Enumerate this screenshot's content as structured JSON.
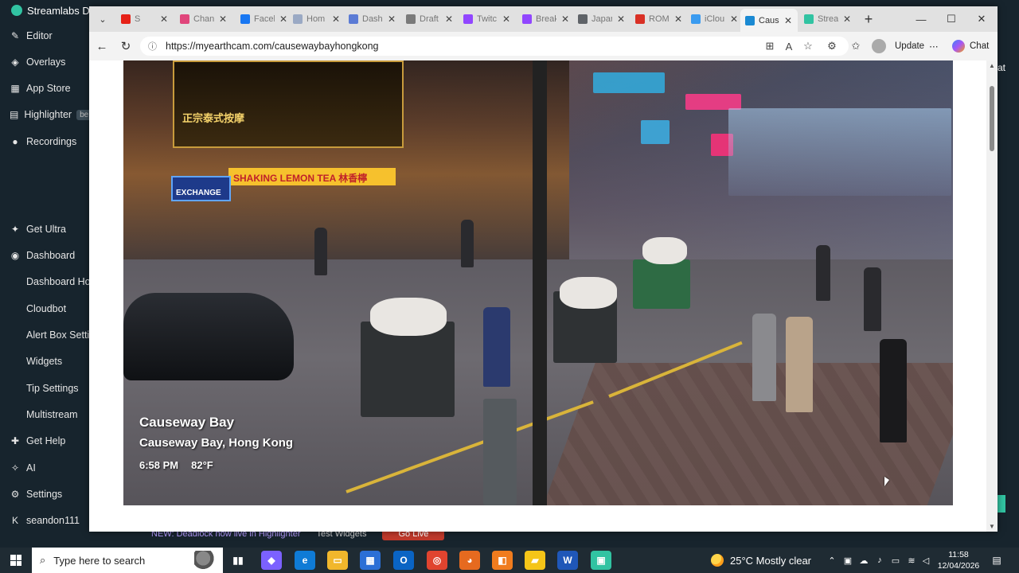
{
  "streamlabs": {
    "title": "Streamlabs Des",
    "nav": [
      {
        "label": "Editor",
        "icon": "pencil-icon",
        "glyph": "✎"
      },
      {
        "label": "Overlays",
        "icon": "overlays-icon",
        "glyph": "◈"
      },
      {
        "label": "App Store",
        "icon": "app-store-icon",
        "glyph": "▦"
      },
      {
        "label": "Highlighter",
        "icon": "highlighter-icon",
        "glyph": "▤",
        "badge": "be"
      },
      {
        "label": "Recordings",
        "icon": "recordings-icon",
        "glyph": "●"
      },
      {
        "label": "Get Ultra",
        "icon": "ultra-icon",
        "glyph": "✦"
      },
      {
        "label": "Dashboard",
        "icon": "dashboard-icon",
        "glyph": "◉"
      },
      {
        "label": "Dashboard Hom"
      },
      {
        "label": "Cloudbot"
      },
      {
        "label": "Alert Box Settin"
      },
      {
        "label": "Widgets"
      },
      {
        "label": "Tip Settings"
      },
      {
        "label": "Multistream"
      },
      {
        "label": "Get Help",
        "icon": "help-icon",
        "glyph": "✚"
      },
      {
        "label": "AI",
        "icon": "ai-icon",
        "glyph": "✧"
      },
      {
        "label": "Settings",
        "icon": "settings-gear-icon",
        "glyph": "⚙"
      },
      {
        "label": "seandon111",
        "icon": "kick-icon",
        "glyph": "K"
      }
    ],
    "right_peek": "at",
    "bottom_strip": {
      "news": "NEW: Deadlock now live in Highlighter",
      "test_widgets": "Test Widgets",
      "go_live": "Go Live"
    }
  },
  "browser": {
    "tabs": [
      {
        "label": "S",
        "color": "#e62117",
        "active": false
      },
      {
        "label": "Chan",
        "color": "#e0457b",
        "active": false
      },
      {
        "label": "Faceb",
        "color": "#1877f2",
        "active": false
      },
      {
        "label": "Hom",
        "color": "#9aa9c4",
        "active": false
      },
      {
        "label": "Dashi",
        "color": "#5b7bd5",
        "active": false
      },
      {
        "label": "Draft",
        "color": "#7a7a7a",
        "active": false
      },
      {
        "label": "Twitc",
        "color": "#9146ff",
        "active": false
      },
      {
        "label": "Break",
        "color": "#9146ff",
        "active": false
      },
      {
        "label": "Japan",
        "color": "#5f6368",
        "active": false
      },
      {
        "label": "ROM",
        "color": "#d93025",
        "active": false
      },
      {
        "label": "iClou",
        "color": "#3a9bf0",
        "active": false
      },
      {
        "label": "Caus",
        "color": "#1b8ad3",
        "active": true
      },
      {
        "label": "Strea",
        "color": "#31c3a2",
        "active": false
      }
    ],
    "url": "https://myearthcam.com/causewaybayhongkong",
    "update_label": "Update",
    "chat_label": "Chat"
  },
  "cam": {
    "title": "Causeway Bay",
    "location": "Causeway Bay, Hong Kong",
    "time": "6:58 PM",
    "temp": "82°F",
    "signs": {
      "thai": "正宗泰式按摩",
      "lemontea": "SHAKING LEMON TEA 林香檸",
      "exchange": "EXCHANGE"
    }
  },
  "taskbar": {
    "search_placeholder": "Type here to search",
    "apps": [
      {
        "name": "task-view",
        "color": "#1f2b33",
        "glyph": "▮▮"
      },
      {
        "name": "copilot",
        "color": "#7b61ff",
        "glyph": "◆"
      },
      {
        "name": "edge",
        "color": "#0f7bd6",
        "glyph": "e"
      },
      {
        "name": "file-explorer",
        "color": "#f1b72c",
        "glyph": "▭"
      },
      {
        "name": "store",
        "color": "#2b6fd6",
        "glyph": "▦"
      },
      {
        "name": "outlook",
        "color": "#0a64c4",
        "glyph": "O"
      },
      {
        "name": "chrome",
        "color": "#e0442f",
        "glyph": "◎"
      },
      {
        "name": "firefox",
        "color": "#e66a1f",
        "glyph": "◕"
      },
      {
        "name": "app-orange",
        "color": "#f07c1e",
        "glyph": "◧"
      },
      {
        "name": "sticky-notes",
        "color": "#f5c518",
        "glyph": "▰"
      },
      {
        "name": "word",
        "color": "#1f57b8",
        "glyph": "W"
      },
      {
        "name": "streamlabs",
        "color": "#31c3a2",
        "glyph": "▣"
      }
    ],
    "weather": "25°C  Mostly clear",
    "time": "11:58",
    "date": "12/04/2026"
  }
}
